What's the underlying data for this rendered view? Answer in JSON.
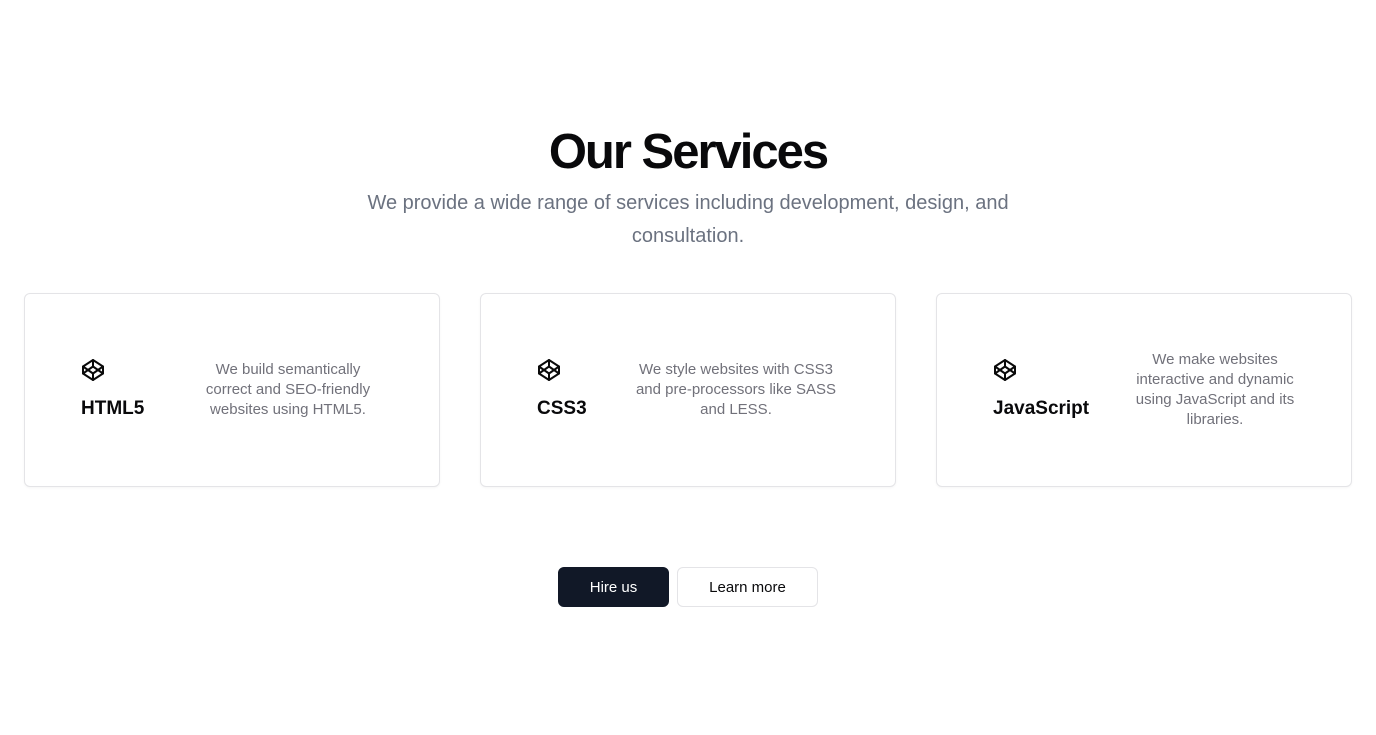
{
  "hero": {
    "title": "Our Services",
    "subtitle": "We provide a wide range of services including development, design, and consultation."
  },
  "services": [
    {
      "icon": "codepen-icon",
      "title": "HTML5",
      "description": "We build semantically correct and SEO-friendly websites using HTML5."
    },
    {
      "icon": "codepen-icon",
      "title": "CSS3",
      "description": "We style websites with CSS3 and pre-processors like SASS and LESS."
    },
    {
      "icon": "codepen-icon",
      "title": "JavaScript",
      "description": "We make websites interactive and dynamic using JavaScript and its libraries."
    }
  ],
  "actions": {
    "primary_label": "Hire us",
    "secondary_label": "Learn more"
  },
  "colors": {
    "primary_button": "#111827",
    "muted_text": "#6b7280",
    "card_border": "#e4e4e7"
  }
}
